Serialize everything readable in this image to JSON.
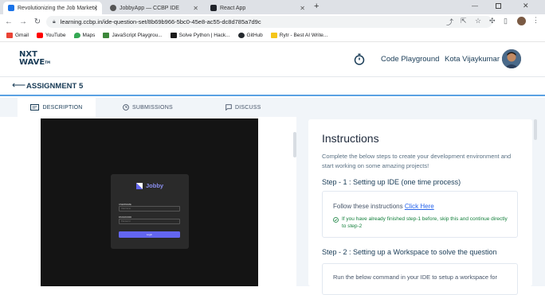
{
  "browser": {
    "tabs": [
      {
        "title": "Revolutionizing the Job Market |",
        "active": true
      },
      {
        "title": "JobbyApp — CCBP IDE",
        "active": false
      },
      {
        "title": "React App",
        "active": false
      }
    ],
    "new_tab": "+",
    "url": "learning.ccbp.in/ide-question-set/8b69b966-5bc0-45e8-ac55-dc8d785a7d9c",
    "bookmarks": [
      {
        "label": "Gmail",
        "color": "#ea4335"
      },
      {
        "label": "YouTube",
        "color": "#ff0000"
      },
      {
        "label": "Maps",
        "color": "#34a853"
      },
      {
        "label": "JavaScript Playgrou...",
        "color": "#3c873a"
      },
      {
        "label": "Solve Python | Hack...",
        "color": "#1ba94c"
      },
      {
        "label": "GitHub",
        "color": "#24292e"
      },
      {
        "label": "Rytr - Best AI Write...",
        "color": "#f5c518"
      }
    ]
  },
  "header": {
    "logo_line1": "NXT",
    "logo_line2": "WAVE",
    "logo_tm": "TM",
    "code_playground": "Code Playground",
    "user_name": "Kota Vijaykumar"
  },
  "assignment": {
    "title": "ASSIGNMENT 5"
  },
  "tabs": [
    {
      "label": "DESCRIPTION",
      "icon": "document-icon",
      "active": true
    },
    {
      "label": "SUBMISSIONS",
      "icon": "clock-icon",
      "active": false
    },
    {
      "label": "DISCUSS",
      "icon": "chat-icon",
      "active": false
    }
  ],
  "preview": {
    "brand": "Jobby",
    "username_label": "USERNAME",
    "username_placeholder": "Username",
    "password_label": "PASSWORD",
    "password_placeholder": "Password",
    "login_label": "Login"
  },
  "instructions": {
    "heading": "Instructions",
    "intro": "Complete the below steps to create your development environment and start working on some amazing projects!",
    "step1_title": "Step - 1 : Setting up IDE (one time process)",
    "step1_text": "Follow these instructions ",
    "step1_link": "Click Here",
    "step1_note": "If you have already finished step-1 before, skip this and continue directly to step-2",
    "step2_title": "Step - 2 : Setting up a Workspace to solve the question",
    "step2_text": "Run the below command in your IDE to setup a workspace for"
  },
  "colors": {
    "brand_navy": "#183b56",
    "accent_blue": "#5aa1e3",
    "link_blue": "#2563eb",
    "note_green": "#15803d",
    "login_purple": "#6366f1"
  }
}
